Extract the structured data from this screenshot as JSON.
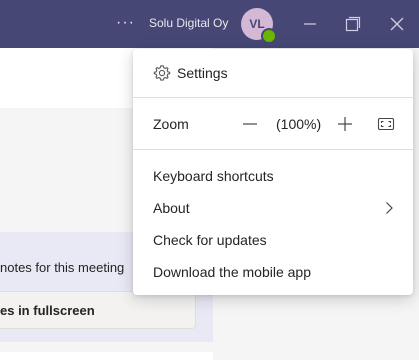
{
  "titlebar": {
    "more_glyph": "···",
    "org_name": "Solu Digital Oy",
    "avatar_initials": "VL",
    "background": "#464775"
  },
  "content": {
    "notes_text": "notes for this meeting",
    "fullscreen_label": "es in fullscreen"
  },
  "menu": {
    "settings_label": "Settings",
    "zoom_label": "Zoom",
    "zoom_value": "(100%)",
    "keyboard_shortcuts_label": "Keyboard shortcuts",
    "about_label": "About",
    "check_updates_label": "Check for updates",
    "download_app_label": "Download the mobile app"
  },
  "icons": [
    "more-icon",
    "gear-icon",
    "minus-icon",
    "plus-icon",
    "fullscreen-icon",
    "chevron-right-icon",
    "minimize-icon",
    "restore-icon",
    "close-icon"
  ],
  "colors": {
    "accent": "#464775",
    "presence": "#6bb700",
    "menu_text": "#252423"
  }
}
